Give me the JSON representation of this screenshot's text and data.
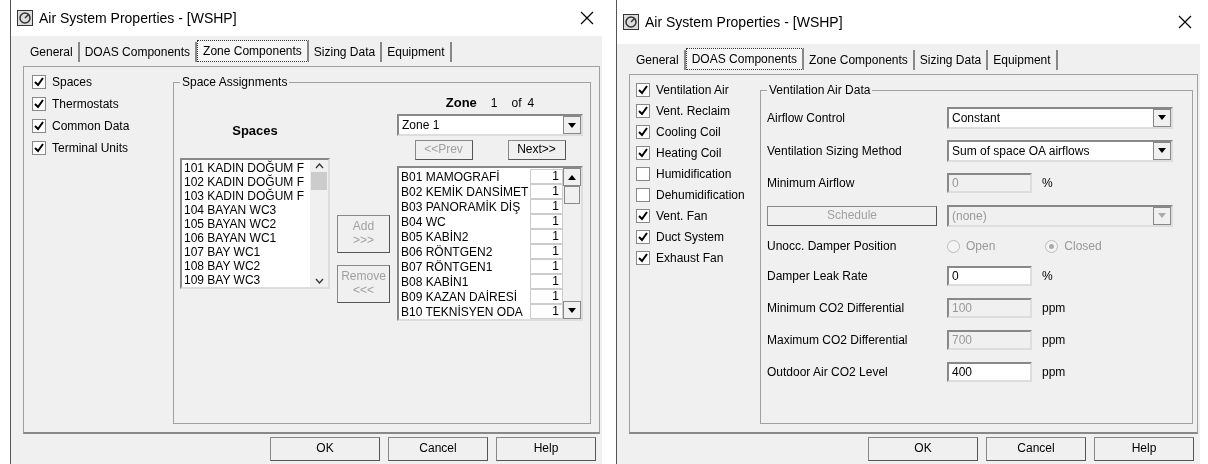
{
  "zone_dialog": {
    "title": "Air System Properties - [WSHP]",
    "tabs": [
      {
        "label": "General",
        "selected": false
      },
      {
        "label": "DOAS Components",
        "selected": false
      },
      {
        "label": "Zone Components",
        "selected": true
      },
      {
        "label": "Sizing Data",
        "selected": false
      },
      {
        "label": "Equipment",
        "selected": false
      }
    ],
    "components": [
      {
        "label": "Spaces",
        "checked": true
      },
      {
        "label": "Thermostats",
        "checked": true
      },
      {
        "label": "Common Data",
        "checked": true
      },
      {
        "label": "Terminal Units",
        "checked": true
      }
    ],
    "group_title": "Space Assignments",
    "spaces_heading": "Spaces",
    "zone_label": "Zone",
    "zone_number": "1",
    "zone_of": "of",
    "zone_total": "4",
    "zone_select": "Zone 1",
    "prev_button": {
      "label": "<<Prev",
      "disabled": true
    },
    "next_button": {
      "label": "Next>>",
      "disabled": false
    },
    "spaces": [
      "101 KADIN DOĞUM F",
      "102 KADIN DOĞUM F",
      "103 KADIN DOĞUM F",
      "104 BAYAN WC3",
      "105 BAYAN WC2",
      "106 BAYAN WC1",
      "107 BAY WC1",
      "108 BAY WC2",
      "109 BAY WC3"
    ],
    "add_button": {
      "label": "Add",
      "arrows": ">>>",
      "disabled": true
    },
    "remove_button": {
      "label": "Remove",
      "arrows": "<<<",
      "disabled": true
    },
    "assigned": [
      {
        "name": "B01 MAMOGRAFİ",
        "count": "1"
      },
      {
        "name": "B02 KEMİK DANSİMET",
        "count": "1"
      },
      {
        "name": "B03 PANORAMİK DİŞ",
        "count": "1"
      },
      {
        "name": "B04 WC",
        "count": "1"
      },
      {
        "name": "B05 KABİN2",
        "count": "1"
      },
      {
        "name": "B06 RÖNTGEN2",
        "count": "1"
      },
      {
        "name": "B07 RÖNTGEN1",
        "count": "1"
      },
      {
        "name": "B08 KABİN1",
        "count": "1"
      },
      {
        "name": "B09 KAZAN DAİRESİ",
        "count": "1"
      },
      {
        "name": "B10 TEKNİSYEN ODA",
        "count": "1"
      }
    ],
    "buttons": [
      "OK",
      "Cancel",
      "Help"
    ]
  },
  "doas_dialog": {
    "title": "Air System Properties - [WSHP]",
    "tabs": [
      {
        "label": "General",
        "selected": false
      },
      {
        "label": "DOAS Components",
        "selected": true
      },
      {
        "label": "Zone Components",
        "selected": false
      },
      {
        "label": "Sizing Data",
        "selected": false
      },
      {
        "label": "Equipment",
        "selected": false
      }
    ],
    "components": [
      {
        "label": "Ventilation Air",
        "checked": true
      },
      {
        "label": "Vent. Reclaim",
        "checked": true
      },
      {
        "label": "Cooling Coil",
        "checked": true
      },
      {
        "label": "Heating Coil",
        "checked": true
      },
      {
        "label": "Humidification",
        "checked": false
      },
      {
        "label": "Dehumidification",
        "checked": false
      },
      {
        "label": "Vent. Fan",
        "checked": true
      },
      {
        "label": "Duct System",
        "checked": true
      },
      {
        "label": "Exhaust Fan",
        "checked": true
      }
    ],
    "group_title": "Ventilation Air Data",
    "rows": [
      {
        "kind": "select",
        "label": "Airflow Control",
        "value": "Constant",
        "disabled": false
      },
      {
        "kind": "select",
        "label": "Ventilation Sizing Method",
        "value": "Sum of space OA airflows",
        "disabled": false
      },
      {
        "kind": "input",
        "label": "Minimum Airflow",
        "value": "0",
        "unit": "%",
        "disabled": true
      },
      {
        "kind": "button_select",
        "label": "Schedule",
        "value": "(none)",
        "disabled": true
      },
      {
        "kind": "radio",
        "label": "Unocc. Damper Position",
        "options": [
          {
            "label": "Open",
            "selected": false
          },
          {
            "label": "Closed",
            "selected": true
          }
        ],
        "disabled": true
      },
      {
        "kind": "input",
        "label": "Damper Leak Rate",
        "value": "0",
        "unit": "%",
        "disabled": false
      },
      {
        "kind": "input",
        "label": "Minimum CO2 Differential",
        "value": "100",
        "unit": "ppm",
        "disabled": true
      },
      {
        "kind": "input",
        "label": "Maximum CO2 Differential",
        "value": "700",
        "unit": "ppm",
        "disabled": true
      },
      {
        "kind": "input",
        "label": "Outdoor Air CO2 Level",
        "value": "400",
        "unit": "ppm",
        "disabled": false
      }
    ],
    "buttons": [
      "OK",
      "Cancel",
      "Help"
    ]
  }
}
